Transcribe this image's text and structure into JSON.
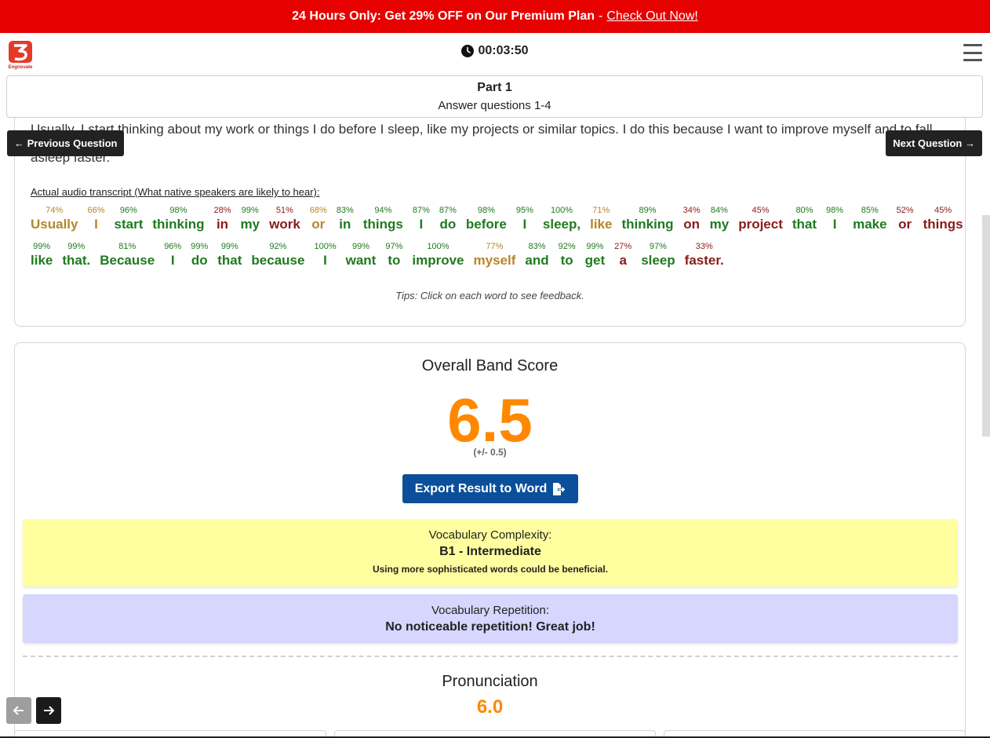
{
  "promo": {
    "text": "24 Hours Only: Get 29% OFF on Our Premium Plan",
    "separator": "-",
    "link": "Check Out Now!"
  },
  "header": {
    "logo_text": "Engnovate",
    "timer": "00:03:50"
  },
  "part": {
    "title": "Part 1",
    "subtitle": "Answer questions 1-4"
  },
  "nav": {
    "prev_label": "← Previous Question",
    "next_label": "Next Question →"
  },
  "answer": {
    "text": "Usually, I start thinking about my work or things I do before I sleep, like my projects or similar topics. I do this because I want to improve myself and to fall asleep faster.",
    "transcript_label": "Actual audio transcript (What native speakers are likely to hear):",
    "tips": "Tips: Click on each word to see feedback."
  },
  "transcript_lines": [
    [
      {
        "w": "Usually",
        "p": "74%",
        "c": "#b5862a"
      },
      {
        "w": "I",
        "p": "66%",
        "c": "#b5862a"
      },
      {
        "w": "start",
        "p": "96%",
        "c": "#1f7a1f"
      },
      {
        "w": "thinking",
        "p": "98%",
        "c": "#1f7a1f"
      },
      {
        "w": "in",
        "p": "28%",
        "c": "#8b1a1a"
      },
      {
        "w": "my",
        "p": "99%",
        "c": "#1f7a1f"
      },
      {
        "w": "work",
        "p": "51%",
        "c": "#8b1a1a"
      },
      {
        "w": "or",
        "p": "68%",
        "c": "#b5862a"
      },
      {
        "w": "in",
        "p": "83%",
        "c": "#1f7a1f"
      },
      {
        "w": "things",
        "p": "94%",
        "c": "#1f7a1f"
      },
      {
        "w": "I",
        "p": "87%",
        "c": "#1f7a1f"
      },
      {
        "w": "do",
        "p": "87%",
        "c": "#1f7a1f"
      },
      {
        "w": "before",
        "p": "98%",
        "c": "#1f7a1f"
      },
      {
        "w": "I",
        "p": "95%",
        "c": "#1f7a1f"
      },
      {
        "w": "sleep,",
        "p": "100%",
        "c": "#1f7a1f"
      },
      {
        "w": "like",
        "p": "71%",
        "c": "#b5862a"
      },
      {
        "w": "thinking",
        "p": "89%",
        "c": "#1f7a1f"
      },
      {
        "w": "on",
        "p": "34%",
        "c": "#8b1a1a"
      },
      {
        "w": "my",
        "p": "84%",
        "c": "#1f7a1f"
      },
      {
        "w": "project",
        "p": "45%",
        "c": "#8b1a1a"
      },
      {
        "w": "that",
        "p": "80%",
        "c": "#1f7a1f"
      },
      {
        "w": "I",
        "p": "98%",
        "c": "#1f7a1f"
      },
      {
        "w": "make",
        "p": "85%",
        "c": "#1f7a1f"
      },
      {
        "w": "or",
        "p": "52%",
        "c": "#8b1a1a"
      },
      {
        "w": "things",
        "p": "45%",
        "c": "#8b1a1a"
      }
    ],
    [
      {
        "w": "like",
        "p": "99%",
        "c": "#1f7a1f"
      },
      {
        "w": "that.",
        "p": "99%",
        "c": "#1f7a1f"
      },
      {
        "w": "Because",
        "p": "81%",
        "c": "#1f7a1f"
      },
      {
        "w": "I",
        "p": "96%",
        "c": "#1f7a1f"
      },
      {
        "w": "do",
        "p": "99%",
        "c": "#1f7a1f"
      },
      {
        "w": "that",
        "p": "99%",
        "c": "#1f7a1f"
      },
      {
        "w": "because",
        "p": "92%",
        "c": "#1f7a1f"
      },
      {
        "w": "I",
        "p": "100%",
        "c": "#1f7a1f"
      },
      {
        "w": "want",
        "p": "99%",
        "c": "#1f7a1f"
      },
      {
        "w": "to",
        "p": "97%",
        "c": "#1f7a1f"
      },
      {
        "w": "improve",
        "p": "100%",
        "c": "#1f7a1f"
      },
      {
        "w": "myself",
        "p": "77%",
        "c": "#b5862a"
      },
      {
        "w": "and",
        "p": "83%",
        "c": "#1f7a1f"
      },
      {
        "w": "to",
        "p": "92%",
        "c": "#1f7a1f"
      },
      {
        "w": "get",
        "p": "99%",
        "c": "#1f7a1f"
      },
      {
        "w": "a",
        "p": "27%",
        "c": "#8b1a1a"
      },
      {
        "w": "sleep",
        "p": "97%",
        "c": "#1f7a1f"
      },
      {
        "w": "faster.",
        "p": "33%",
        "c": "#8b1a1a"
      }
    ]
  ],
  "overall": {
    "title": "Overall Band Score",
    "score": "6.5",
    "margin": "(+/- 0.5)",
    "score_color": "#ff8800"
  },
  "export": {
    "label": "Export Result to Word",
    "icon": "file-export-icon"
  },
  "vocab_complexity": {
    "label": "Vocabulary Complexity:",
    "value": "B1 - Intermediate",
    "note": "Using more sophisticated words could be beneficial."
  },
  "vocab_repetition": {
    "label": "Vocabulary Repetition:",
    "value": "No noticeable repetition! Great job!"
  },
  "pronunciation": {
    "title": "Pronunciation",
    "score": "6.0"
  },
  "colors": {
    "promo_bg": "#e60000",
    "export_bg": "#0b4f9a",
    "vocab_complexity_bg": "#ffffa0",
    "vocab_repetition_bg": "#d6d6ff",
    "good": "#1f7a1f",
    "medium": "#b5862a",
    "poor": "#8b1a1a"
  }
}
